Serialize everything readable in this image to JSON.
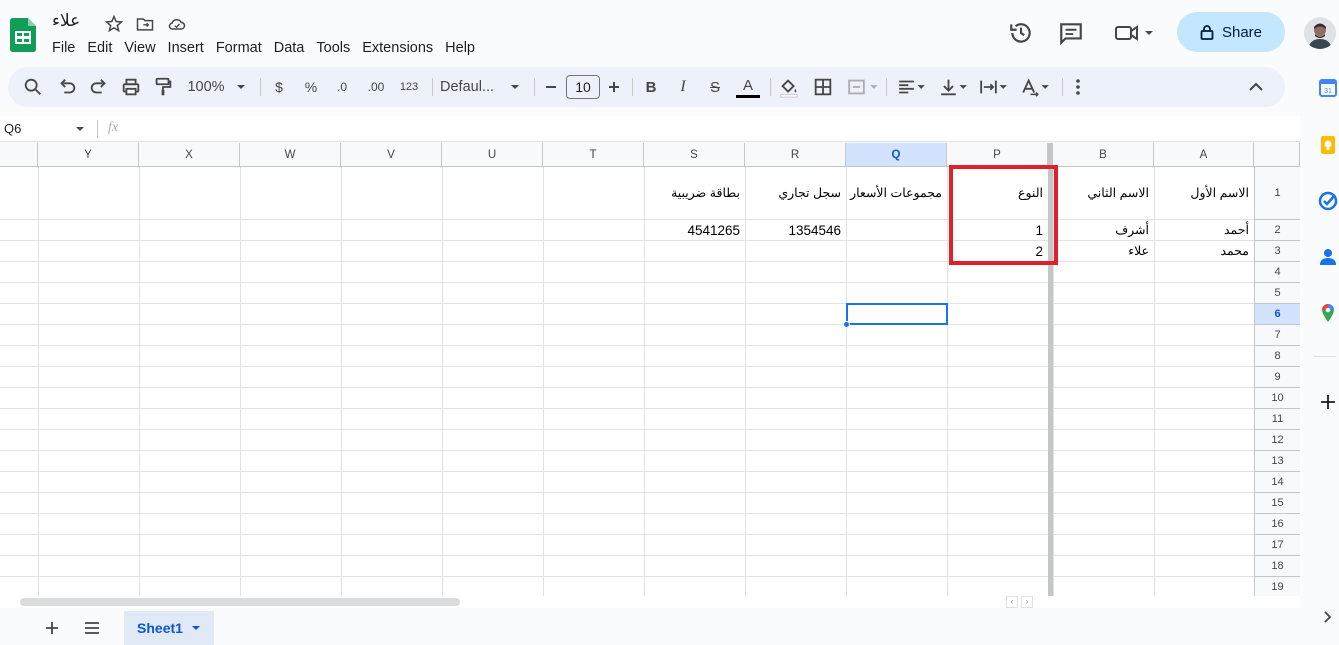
{
  "app": {
    "doc_title": "علاء",
    "menu": [
      "File",
      "Edit",
      "View",
      "Insert",
      "Format",
      "Data",
      "Tools",
      "Extensions",
      "Help"
    ],
    "share_label": "Share"
  },
  "toolbar": {
    "zoom": "100%",
    "currency": "$",
    "percent": "%",
    "dec_decrease": ".0",
    "dec_increase": ".00",
    "number_format": "123",
    "font": "Defaul...",
    "font_size": "10",
    "bold": "B",
    "italic": "I",
    "strike": "S",
    "text_color": "A"
  },
  "formula_bar": {
    "name_box": "Q6",
    "fx": "fx"
  },
  "grid": {
    "columns": [
      "Y",
      "X",
      "W",
      "V",
      "U",
      "T",
      "S",
      "R",
      "Q",
      "P",
      "B",
      "A"
    ],
    "selected_column": "Q",
    "rows": [
      "1",
      "2",
      "3",
      "4",
      "5",
      "6",
      "7",
      "8",
      "9",
      "10",
      "11",
      "12",
      "13",
      "14",
      "15",
      "16",
      "17",
      "18",
      "19"
    ],
    "selected_row": "6",
    "cells": {
      "A1": "الاسم الأول",
      "B1": "الاسم الثاني",
      "P1": "النوع",
      "Q1": "مجموعات الأسعار",
      "R1": "سجل تجاري",
      "S1": "بطاقة ضريبية",
      "A2": "أحمد",
      "B2": "أشرف",
      "P2": "1",
      "R2": "1354546",
      "S2": "4541265",
      "A3": "محمد",
      "B3": "علاء",
      "P3": "2"
    },
    "highlight_color": "#e0202a",
    "selection_color": "#1a73e8"
  },
  "sheets": [
    {
      "label": "Sheet1",
      "active": true
    }
  ]
}
